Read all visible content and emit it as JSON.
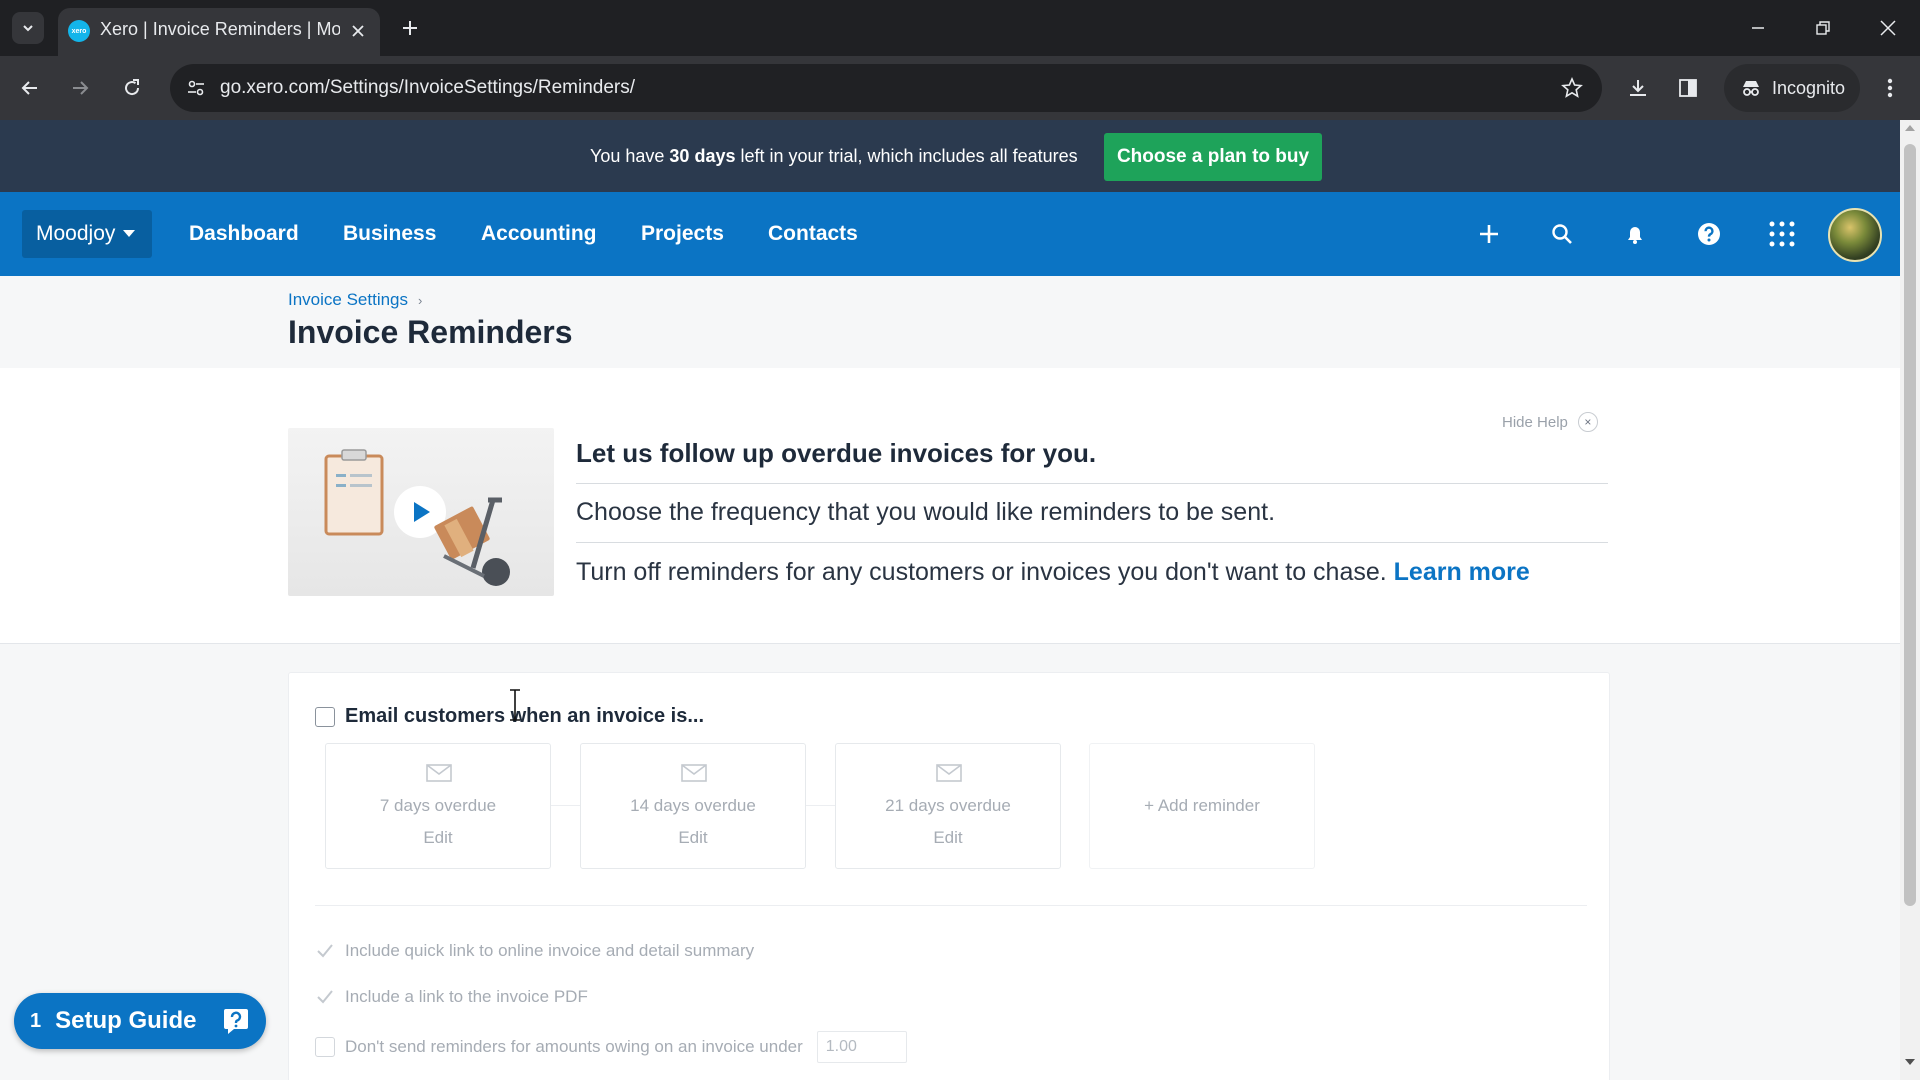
{
  "browser": {
    "tab_title": "Xero | Invoice Reminders | Moodjoy",
    "favicon_text": "xero",
    "url": "go.xero.com/Settings/InvoiceSettings/Reminders/",
    "incognito_label": "Incognito"
  },
  "trial_banner": {
    "text_before": "You have ",
    "days": "30 days",
    "text_after": " left in your trial, which includes all features",
    "button_label": "Choose a plan to buy"
  },
  "nav": {
    "org_name": "Moodjoy",
    "links": [
      "Dashboard",
      "Business",
      "Accounting",
      "Projects",
      "Contacts"
    ]
  },
  "page": {
    "breadcrumb": "Invoice Settings",
    "breadcrumb_separator": "›",
    "title": "Invoice Reminders"
  },
  "help": {
    "hide_label": "Hide Help",
    "close_glyph": "×",
    "heading": "Let us follow up overdue invoices for you.",
    "line1": "Choose the frequency that you would like reminders to be sent.",
    "line2": "Turn off reminders for any customers or invoices you don't want to chase. ",
    "learn_more": "Learn more"
  },
  "reminders": {
    "main_checkbox_label": "Email customers when an invoice is...",
    "items": [
      {
        "label": "7 days overdue",
        "action": "Edit"
      },
      {
        "label": "14 days overdue",
        "action": "Edit"
      },
      {
        "label": "21 days overdue",
        "action": "Edit"
      }
    ],
    "add_label": "+ Add reminder",
    "options": {
      "quick_link": "Include quick link to online invoice and detail summary",
      "pdf_link": "Include a link to the invoice PDF",
      "min_amount_label": "Don't send reminders for amounts owing on an invoice under",
      "min_amount_value": "1.00"
    }
  },
  "setup_guide": {
    "count": "1",
    "label": "Setup Guide"
  },
  "colors": {
    "nav_blue": "#0b74c4",
    "banner_navy": "#2b3a4f",
    "buy_green": "#1ea35a"
  }
}
